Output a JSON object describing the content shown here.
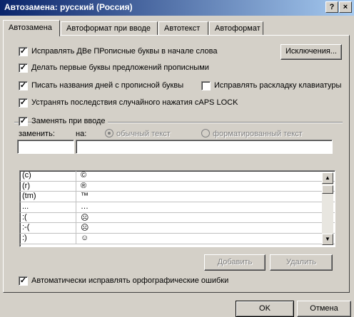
{
  "window": {
    "title": "Автозамена: русский (Россия)",
    "help_button": "?",
    "close_button": "×"
  },
  "tabs": [
    {
      "label": "Автозамена",
      "active": true
    },
    {
      "label": "Автоформат при вводе",
      "active": false
    },
    {
      "label": "Автотекст",
      "active": false
    },
    {
      "label": "Автоформат",
      "active": false
    }
  ],
  "options": {
    "fix_two_caps": {
      "label": "Исправлять ДВе ПРописные буквы в начале слова",
      "checked": true
    },
    "capitalize_sentences": {
      "label": "Делать первые буквы предложений прописными",
      "checked": true
    },
    "capitalize_days": {
      "label": "Писать названия дней с прописной буквы",
      "checked": true
    },
    "fix_keyboard_layout": {
      "label": "Исправлять раскладку клавиатуры",
      "checked": false
    },
    "fix_caps_lock": {
      "label": "Устранять последствия случайного нажатия cAPS LOCK",
      "checked": true
    },
    "replace_as_you_type": {
      "label": "Заменять при вводе",
      "checked": true
    },
    "auto_spellcheck": {
      "label": "Автоматически исправлять орфографические ошибки",
      "checked": true
    }
  },
  "exceptions_button": "Исключения...",
  "replace_section": {
    "replace_label": "заменить:",
    "with_label": "на:",
    "plain_text_label": "обычный текст",
    "formatted_text_label": "форматированный текст",
    "replace_value": "",
    "with_value": ""
  },
  "entries": [
    {
      "from": "(c)",
      "to": "©"
    },
    {
      "from": "(r)",
      "to": "®"
    },
    {
      "from": "(tm)",
      "to": "™"
    },
    {
      "from": "...",
      "to": "…"
    },
    {
      "from": ":(",
      "to": "☹"
    },
    {
      "from": ":-(",
      "to": "☹"
    },
    {
      "from": ":)",
      "to": "☺"
    }
  ],
  "buttons": {
    "add": "Добавить",
    "delete": "Удалить",
    "ok": "OK",
    "cancel": "Отмена"
  },
  "icons": {
    "scroll_up": "up-arrow-icon",
    "scroll_down": "down-arrow-icon"
  }
}
